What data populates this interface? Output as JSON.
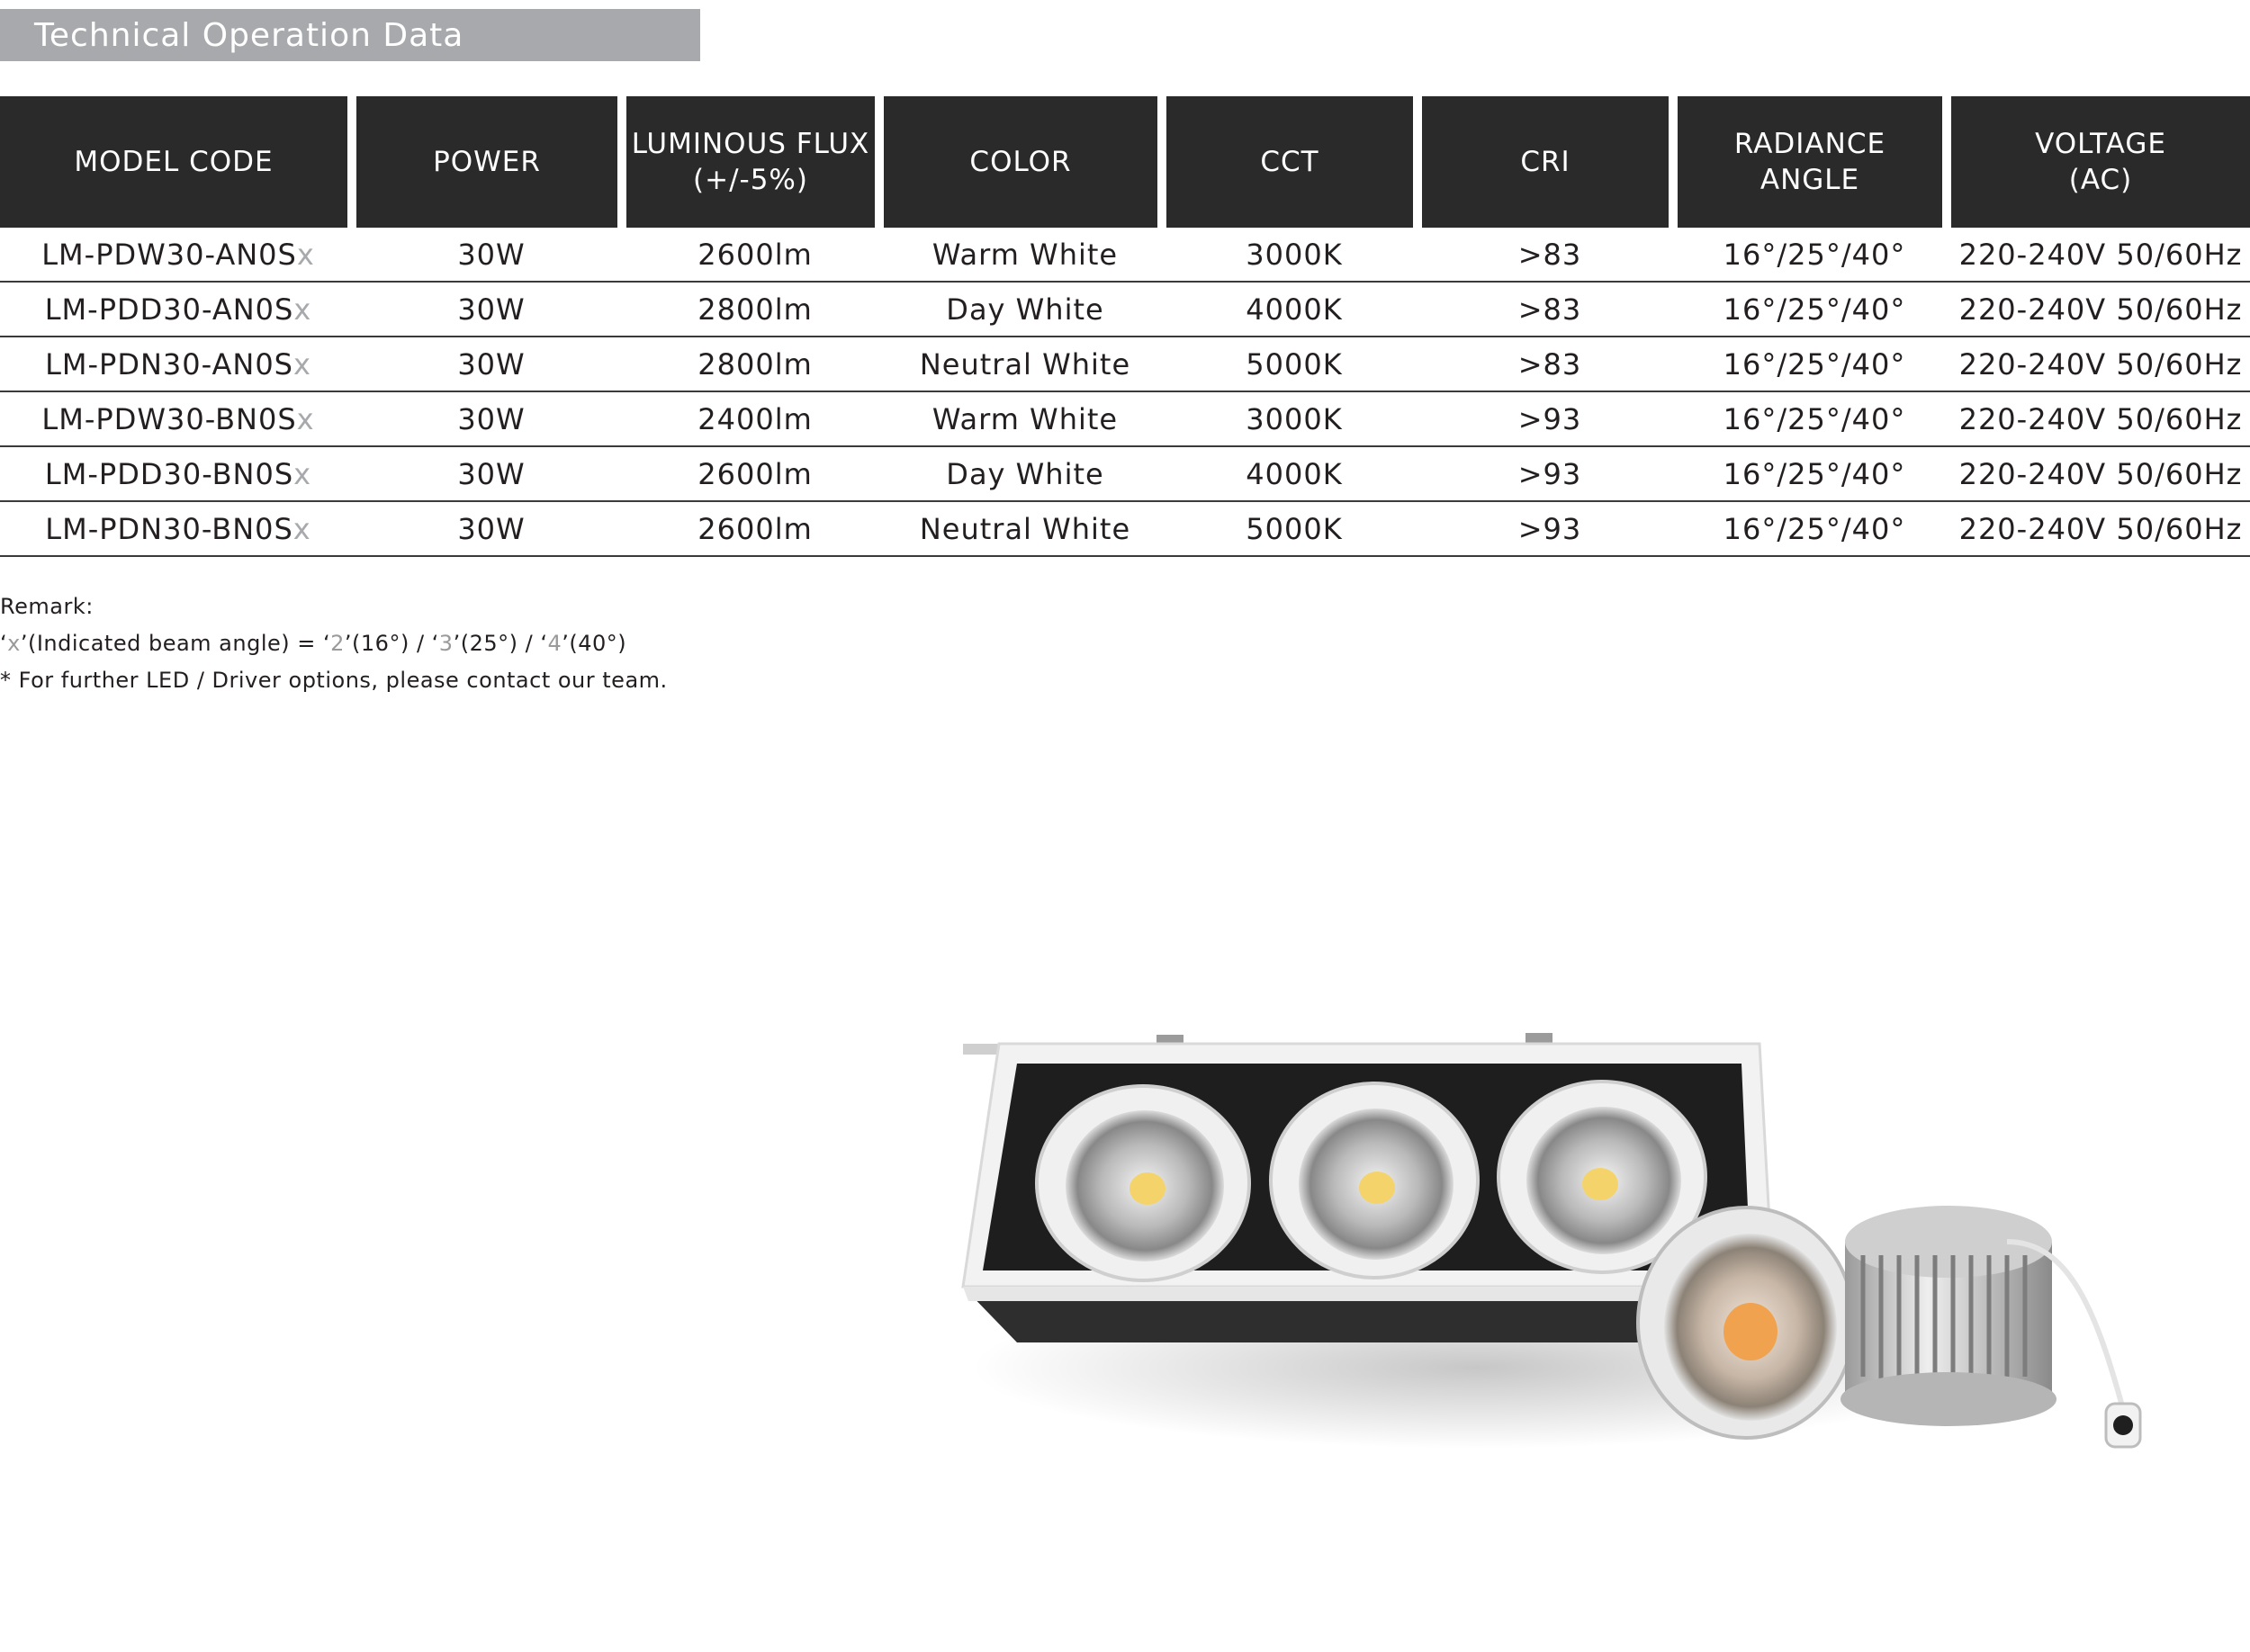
{
  "header": {
    "title": "Technical Operation Data"
  },
  "table": {
    "columns": [
      "MODEL CODE",
      "POWER",
      "LUMINOUS FLUX\n(+/-5%)",
      "COLOR",
      "CCT",
      "CRI",
      "RADIANCE\nANGLE",
      "VOLTAGE\n(AC)"
    ],
    "rows": [
      {
        "model": "LM-PDW30-AN0S",
        "suffix": "x",
        "power": "30W",
        "flux": "2600lm",
        "color": "Warm White",
        "cct": "3000K",
        "cri": ">83",
        "angle": "16°/25°/40°",
        "voltage": "220-240V 50/60Hz"
      },
      {
        "model": "LM-PDD30-AN0S",
        "suffix": "x",
        "power": "30W",
        "flux": "2800lm",
        "color": "Day White",
        "cct": "4000K",
        "cri": ">83",
        "angle": "16°/25°/40°",
        "voltage": "220-240V 50/60Hz"
      },
      {
        "model": "LM-PDN30-AN0S",
        "suffix": "x",
        "power": "30W",
        "flux": "2800lm",
        "color": "Neutral White",
        "cct": "5000K",
        "cri": ">83",
        "angle": "16°/25°/40°",
        "voltage": "220-240V 50/60Hz"
      },
      {
        "model": "LM-PDW30-BN0S",
        "suffix": "x",
        "power": "30W",
        "flux": "2400lm",
        "color": "Warm White",
        "cct": "3000K",
        "cri": ">93",
        "angle": "16°/25°/40°",
        "voltage": "220-240V 50/60Hz"
      },
      {
        "model": "LM-PDD30-BN0S",
        "suffix": "x",
        "power": "30W",
        "flux": "2600lm",
        "color": "Day White",
        "cct": "4000K",
        "cri": ">93",
        "angle": "16°/25°/40°",
        "voltage": "220-240V 50/60Hz"
      },
      {
        "model": "LM-PDN30-BN0S",
        "suffix": "x",
        "power": "30W",
        "flux": "2600lm",
        "color": "Neutral White",
        "cct": "5000K",
        "cri": ">93",
        "angle": "16°/25°/40°",
        "voltage": "220-240V 50/60Hz"
      }
    ]
  },
  "remarks": {
    "heading": "Remark:",
    "line1": {
      "q1": "‘",
      "x": "x",
      "t1": "’(Indicated beam angle) = ‘",
      "v2": "2",
      "t2": "’(16°)  / ‘",
      "v3": "3",
      "t3": "’(25°)  / ‘",
      "v4": "4",
      "t4": "’(40°)"
    },
    "line2": "* For further LED / Driver options, please contact our team."
  },
  "colors": {
    "title_bar": "#a7a9ac",
    "header_bg": "#2b2a2a",
    "suffix_grey": "#a7a9ac"
  },
  "image": {
    "subject": "triple-head recessed LED grille downlight with separate LED module and heat sink"
  }
}
